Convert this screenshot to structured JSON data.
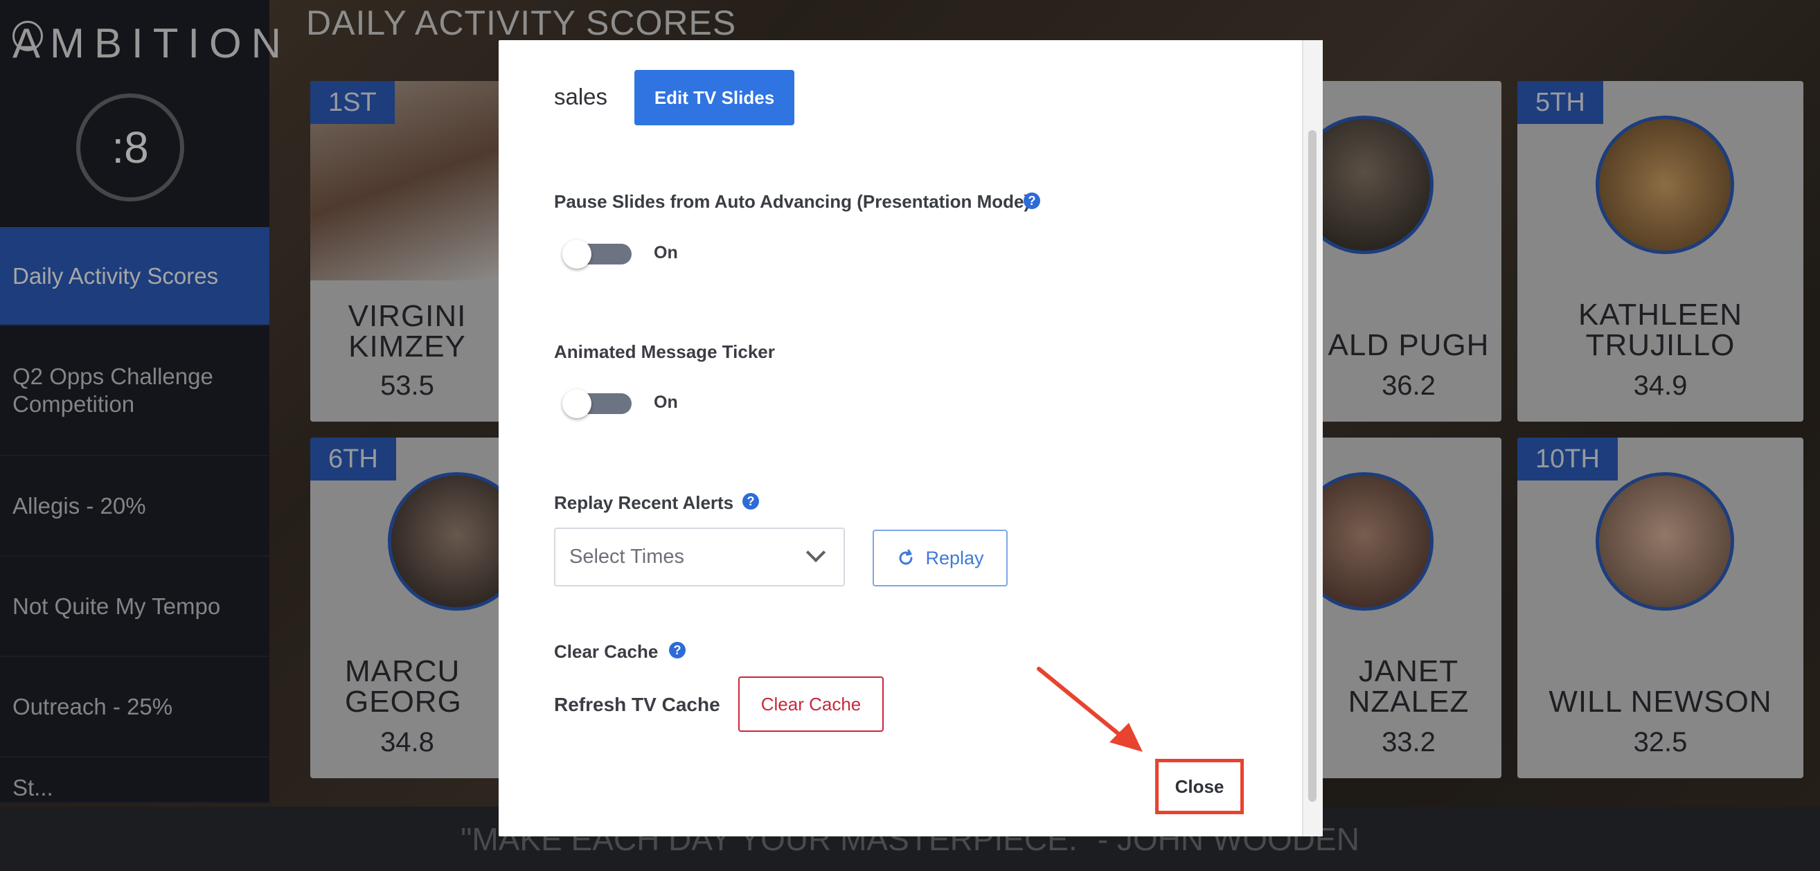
{
  "app": {
    "logo": "AMBITION",
    "timer": ":8",
    "page_title": "DAILY ACTIVITY SCORES",
    "quote": "\"MAKE EACH DAY YOUR MASTERPIECE.\" - JOHN WOODEN"
  },
  "sidebar": {
    "items": [
      {
        "label": "Daily Activity Scores",
        "active": true
      },
      {
        "label": "Q2 Opps Challenge Competition",
        "active": false
      },
      {
        "label": "Allegis - 20%",
        "active": false
      },
      {
        "label": "Not Quite My Tempo",
        "active": false
      },
      {
        "label": "Outreach - 25%",
        "active": false
      },
      {
        "label": "St...",
        "active": false
      }
    ]
  },
  "leaderboard": {
    "cards": [
      {
        "rank": "1ST",
        "name": "VIRGINI KIMZEY",
        "score": "53.5"
      },
      {
        "rank": "",
        "name": "ALD PUGH",
        "score": "36.2"
      },
      {
        "rank": "5TH",
        "name": "KATHLEEN TRUJILLO",
        "score": "34.9"
      },
      {
        "rank": "6TH",
        "name": "MARCU GEORG",
        "score": "34.8"
      },
      {
        "rank": "",
        "name": "JANET NZALEZ",
        "score": "33.2"
      },
      {
        "rank": "10TH",
        "name": "WILL NEWSON",
        "score": "32.5"
      }
    ]
  },
  "modal": {
    "group_name": "sales",
    "edit_button": "Edit TV Slides",
    "pause_label": "Pause Slides from Auto Advancing (Presentation Mode)",
    "pause_toggle_text": "On",
    "ticker_label": "Animated Message Ticker",
    "ticker_toggle_text": "On",
    "replay_label": "Replay Recent Alerts",
    "select_placeholder": "Select Times",
    "replay_button": "Replay",
    "clear_cache_label": "Clear Cache",
    "refresh_label": "Refresh TV Cache",
    "clear_cache_button": "Clear Cache",
    "close_button": "Close",
    "help_glyph": "?"
  },
  "colors": {
    "primary": "#2f74e0",
    "danger": "#c8283c",
    "highlight": "#e8432e",
    "sidebar_active": "#2d5ebf"
  }
}
